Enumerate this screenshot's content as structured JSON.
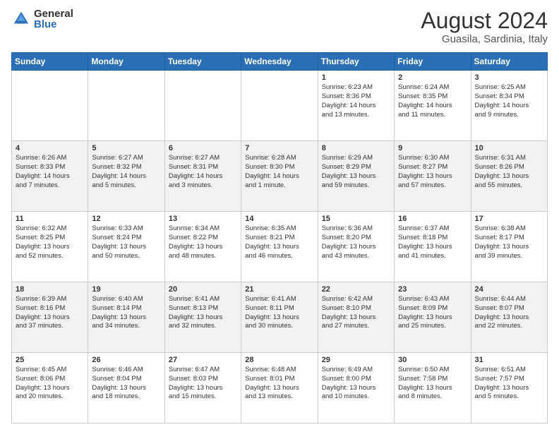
{
  "logo": {
    "general": "General",
    "blue": "Blue"
  },
  "title": "August 2024",
  "location": "Guasila, Sardinia, Italy",
  "days_header": [
    "Sunday",
    "Monday",
    "Tuesday",
    "Wednesday",
    "Thursday",
    "Friday",
    "Saturday"
  ],
  "weeks": [
    [
      {
        "num": "",
        "detail": ""
      },
      {
        "num": "",
        "detail": ""
      },
      {
        "num": "",
        "detail": ""
      },
      {
        "num": "",
        "detail": ""
      },
      {
        "num": "1",
        "detail": "Sunrise: 6:23 AM\nSunset: 8:36 PM\nDaylight: 14 hours\nand 13 minutes."
      },
      {
        "num": "2",
        "detail": "Sunrise: 6:24 AM\nSunset: 8:35 PM\nDaylight: 14 hours\nand 11 minutes."
      },
      {
        "num": "3",
        "detail": "Sunrise: 6:25 AM\nSunset: 8:34 PM\nDaylight: 14 hours\nand 9 minutes."
      }
    ],
    [
      {
        "num": "4",
        "detail": "Sunrise: 6:26 AM\nSunset: 8:33 PM\nDaylight: 14 hours\nand 7 minutes."
      },
      {
        "num": "5",
        "detail": "Sunrise: 6:27 AM\nSunset: 8:32 PM\nDaylight: 14 hours\nand 5 minutes."
      },
      {
        "num": "6",
        "detail": "Sunrise: 6:27 AM\nSunset: 8:31 PM\nDaylight: 14 hours\nand 3 minutes."
      },
      {
        "num": "7",
        "detail": "Sunrise: 6:28 AM\nSunset: 8:30 PM\nDaylight: 14 hours\nand 1 minute."
      },
      {
        "num": "8",
        "detail": "Sunrise: 6:29 AM\nSunset: 8:29 PM\nDaylight: 13 hours\nand 59 minutes."
      },
      {
        "num": "9",
        "detail": "Sunrise: 6:30 AM\nSunset: 8:27 PM\nDaylight: 13 hours\nand 57 minutes."
      },
      {
        "num": "10",
        "detail": "Sunrise: 6:31 AM\nSunset: 8:26 PM\nDaylight: 13 hours\nand 55 minutes."
      }
    ],
    [
      {
        "num": "11",
        "detail": "Sunrise: 6:32 AM\nSunset: 8:25 PM\nDaylight: 13 hours\nand 52 minutes."
      },
      {
        "num": "12",
        "detail": "Sunrise: 6:33 AM\nSunset: 8:24 PM\nDaylight: 13 hours\nand 50 minutes."
      },
      {
        "num": "13",
        "detail": "Sunrise: 6:34 AM\nSunset: 8:22 PM\nDaylight: 13 hours\nand 48 minutes."
      },
      {
        "num": "14",
        "detail": "Sunrise: 6:35 AM\nSunset: 8:21 PM\nDaylight: 13 hours\nand 46 minutes."
      },
      {
        "num": "15",
        "detail": "Sunrise: 6:36 AM\nSunset: 8:20 PM\nDaylight: 13 hours\nand 43 minutes."
      },
      {
        "num": "16",
        "detail": "Sunrise: 6:37 AM\nSunset: 8:18 PM\nDaylight: 13 hours\nand 41 minutes."
      },
      {
        "num": "17",
        "detail": "Sunrise: 6:38 AM\nSunset: 8:17 PM\nDaylight: 13 hours\nand 39 minutes."
      }
    ],
    [
      {
        "num": "18",
        "detail": "Sunrise: 6:39 AM\nSunset: 8:16 PM\nDaylight: 13 hours\nand 37 minutes."
      },
      {
        "num": "19",
        "detail": "Sunrise: 6:40 AM\nSunset: 8:14 PM\nDaylight: 13 hours\nand 34 minutes."
      },
      {
        "num": "20",
        "detail": "Sunrise: 6:41 AM\nSunset: 8:13 PM\nDaylight: 13 hours\nand 32 minutes."
      },
      {
        "num": "21",
        "detail": "Sunrise: 6:41 AM\nSunset: 8:11 PM\nDaylight: 13 hours\nand 30 minutes."
      },
      {
        "num": "22",
        "detail": "Sunrise: 6:42 AM\nSunset: 8:10 PM\nDaylight: 13 hours\nand 27 minutes."
      },
      {
        "num": "23",
        "detail": "Sunrise: 6:43 AM\nSunset: 8:09 PM\nDaylight: 13 hours\nand 25 minutes."
      },
      {
        "num": "24",
        "detail": "Sunrise: 6:44 AM\nSunset: 8:07 PM\nDaylight: 13 hours\nand 22 minutes."
      }
    ],
    [
      {
        "num": "25",
        "detail": "Sunrise: 6:45 AM\nSunset: 8:06 PM\nDaylight: 13 hours\nand 20 minutes."
      },
      {
        "num": "26",
        "detail": "Sunrise: 6:46 AM\nSunset: 8:04 PM\nDaylight: 13 hours\nand 18 minutes."
      },
      {
        "num": "27",
        "detail": "Sunrise: 6:47 AM\nSunset: 8:03 PM\nDaylight: 13 hours\nand 15 minutes."
      },
      {
        "num": "28",
        "detail": "Sunrise: 6:48 AM\nSunset: 8:01 PM\nDaylight: 13 hours\nand 13 minutes."
      },
      {
        "num": "29",
        "detail": "Sunrise: 6:49 AM\nSunset: 8:00 PM\nDaylight: 13 hours\nand 10 minutes."
      },
      {
        "num": "30",
        "detail": "Sunrise: 6:50 AM\nSunset: 7:58 PM\nDaylight: 13 hours\nand 8 minutes."
      },
      {
        "num": "31",
        "detail": "Sunrise: 6:51 AM\nSunset: 7:57 PM\nDaylight: 13 hours\nand 5 minutes."
      }
    ]
  ]
}
